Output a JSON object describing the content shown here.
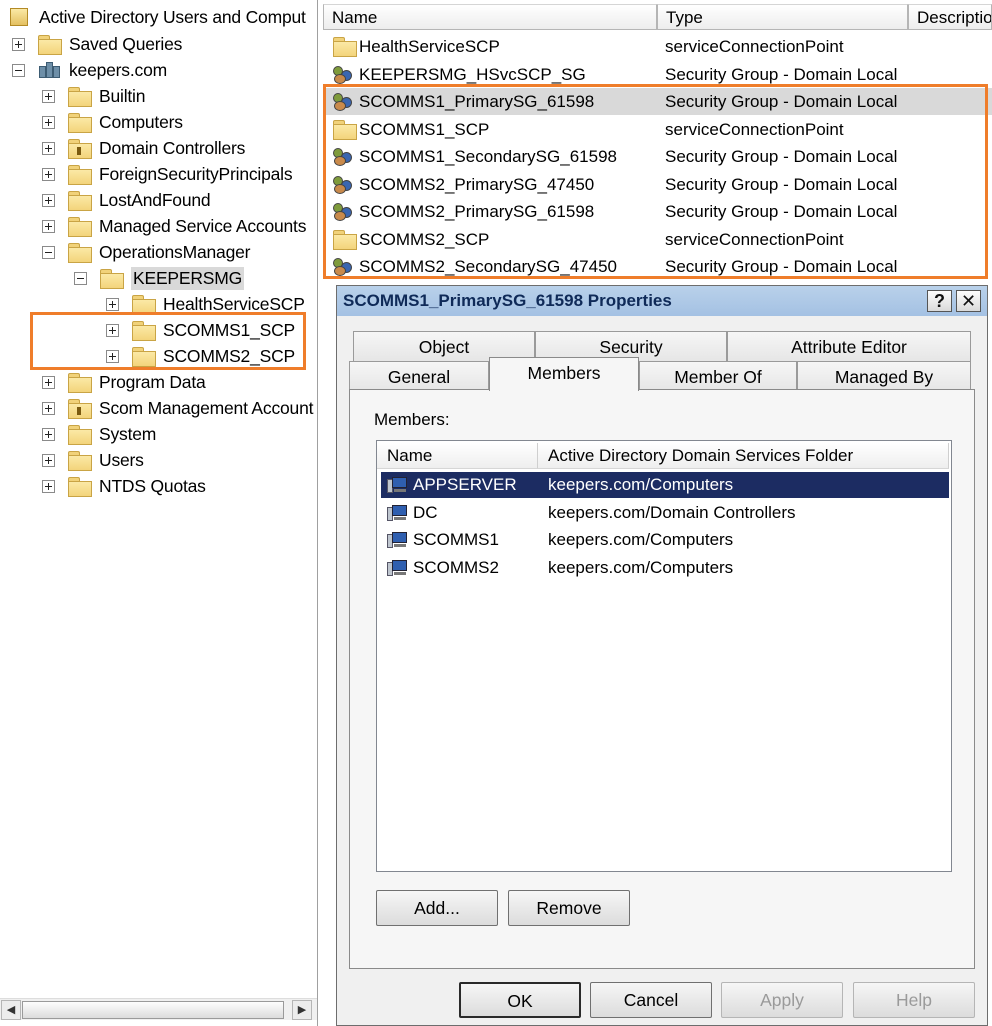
{
  "tree": {
    "root_label": "Active Directory Users and Comput",
    "items": [
      {
        "label": "Saved Queries",
        "expander": "plus",
        "icon": "folder-icon",
        "level": 0
      },
      {
        "label": "keepers.com",
        "expander": "minus",
        "icon": "domain-icon",
        "level": 0
      },
      {
        "label": "Builtin",
        "expander": "plus",
        "icon": "folder-icon",
        "level": 1
      },
      {
        "label": "Computers",
        "expander": "plus",
        "icon": "folder-icon",
        "level": 1
      },
      {
        "label": "Domain Controllers",
        "expander": "plus",
        "icon": "ou-folder-icon",
        "level": 1
      },
      {
        "label": "ForeignSecurityPrincipals",
        "expander": "plus",
        "icon": "folder-icon",
        "level": 1
      },
      {
        "label": "LostAndFound",
        "expander": "plus",
        "icon": "folder-icon",
        "level": 1
      },
      {
        "label": "Managed Service Accounts",
        "expander": "plus",
        "icon": "folder-icon",
        "level": 1
      },
      {
        "label": "OperationsManager",
        "expander": "minus",
        "icon": "folder-icon",
        "level": 1
      },
      {
        "label": "KEEPERSMG",
        "expander": "minus",
        "icon": "folder-icon",
        "level": 2,
        "selected": true
      },
      {
        "label": "HealthServiceSCP",
        "expander": "plus",
        "icon": "folder-icon",
        "level": 3
      },
      {
        "label": "SCOMMS1_SCP",
        "expander": "plus",
        "icon": "folder-icon",
        "level": 3
      },
      {
        "label": "SCOMMS2_SCP",
        "expander": "plus",
        "icon": "folder-icon",
        "level": 3
      },
      {
        "label": "Program Data",
        "expander": "plus",
        "icon": "folder-icon",
        "level": 1
      },
      {
        "label": "Scom Management Account",
        "expander": "plus",
        "icon": "ou-folder-icon",
        "level": 1
      },
      {
        "label": "System",
        "expander": "plus",
        "icon": "folder-icon",
        "level": 1
      },
      {
        "label": "Users",
        "expander": "plus",
        "icon": "folder-icon",
        "level": 1
      },
      {
        "label": "NTDS Quotas",
        "expander": "plus",
        "icon": "folder-icon",
        "level": 1
      }
    ]
  },
  "list": {
    "columns": [
      "Name",
      "Type",
      "Descriptio"
    ],
    "rows": [
      {
        "name": "HealthServiceSCP",
        "type": "serviceConnectionPoint",
        "icon": "folder-icon"
      },
      {
        "name": "KEEPERSMG_HSvcSCP_SG",
        "type": "Security Group - Domain Local",
        "icon": "security-group-icon"
      },
      {
        "name": "SCOMMS1_PrimarySG_61598",
        "type": "Security Group - Domain Local",
        "icon": "security-group-icon",
        "selected": true
      },
      {
        "name": "SCOMMS1_SCP",
        "type": "serviceConnectionPoint",
        "icon": "folder-icon"
      },
      {
        "name": "SCOMMS1_SecondarySG_61598",
        "type": "Security Group - Domain Local",
        "icon": "security-group-icon"
      },
      {
        "name": "SCOMMS2_PrimarySG_47450",
        "type": "Security Group - Domain Local",
        "icon": "security-group-icon"
      },
      {
        "name": "SCOMMS2_PrimarySG_61598",
        "type": "Security Group - Domain Local",
        "icon": "security-group-icon"
      },
      {
        "name": "SCOMMS2_SCP",
        "type": "serviceConnectionPoint",
        "icon": "folder-icon"
      },
      {
        "name": "SCOMMS2_SecondarySG_47450",
        "type": "Security Group - Domain Local",
        "icon": "security-group-icon"
      }
    ]
  },
  "dialog": {
    "title": "SCOMMS1_PrimarySG_61598 Properties",
    "help_button": "?",
    "close_button": "✕",
    "tabs_row1": [
      "Object",
      "Security",
      "Attribute Editor"
    ],
    "tabs_row2": [
      "General",
      "Members",
      "Member Of",
      "Managed By"
    ],
    "active_tab": "Members",
    "members_label": "Members:",
    "members_columns": [
      "Name",
      "Active Directory Domain Services Folder"
    ],
    "members": [
      {
        "name": "APPSERVER",
        "folder": "keepers.com/Computers",
        "selected": true
      },
      {
        "name": "DC",
        "folder": "keepers.com/Domain Controllers"
      },
      {
        "name": "SCOMMS1",
        "folder": "keepers.com/Computers"
      },
      {
        "name": "SCOMMS2",
        "folder": "keepers.com/Computers"
      }
    ],
    "add_button": "Add...",
    "remove_button": "Remove",
    "ok_button": "OK",
    "cancel_button": "Cancel",
    "apply_button": "Apply",
    "help_bottom_button": "Help"
  },
  "colors": {
    "highlight_outline": "#ef7d2a",
    "selection_dark": "#1c2c62",
    "title_bar": "#b9d1ea"
  },
  "scrollbar": {
    "left_arrow": "◀",
    "right_arrow": "▶"
  }
}
